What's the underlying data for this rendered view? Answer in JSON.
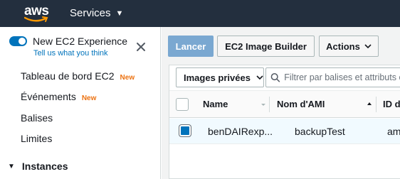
{
  "topbar": {
    "logo_text": "aws",
    "services_label": "Services"
  },
  "sidebar": {
    "new_experience_label": "New EC2 Experience",
    "feedback_link": "Tell us what you think",
    "items": [
      {
        "label": "Tableau de bord EC2",
        "badge": "New"
      },
      {
        "label": "Événements",
        "badge": "New"
      },
      {
        "label": "Balises",
        "badge": ""
      },
      {
        "label": "Limites",
        "badge": ""
      }
    ],
    "section_label": "Instances"
  },
  "toolbar": {
    "launch_label": "Lancer",
    "image_builder_label": "EC2 Image Builder",
    "actions_label": "Actions"
  },
  "filter": {
    "scope_label": "Images privées",
    "search_placeholder": "Filtrer par balises et attributs ou r"
  },
  "table": {
    "columns": [
      "Name",
      "Nom d'AMI",
      "ID d"
    ],
    "rows": [
      {
        "name": "benDAIRexp...",
        "ami_name": "backupTest",
        "id": "am"
      }
    ]
  },
  "colors": {
    "header_bg": "#232f3e",
    "accent": "#0073bb",
    "new_badge": "#ec7211",
    "primary_button_disabled": "#7aa8d1"
  }
}
